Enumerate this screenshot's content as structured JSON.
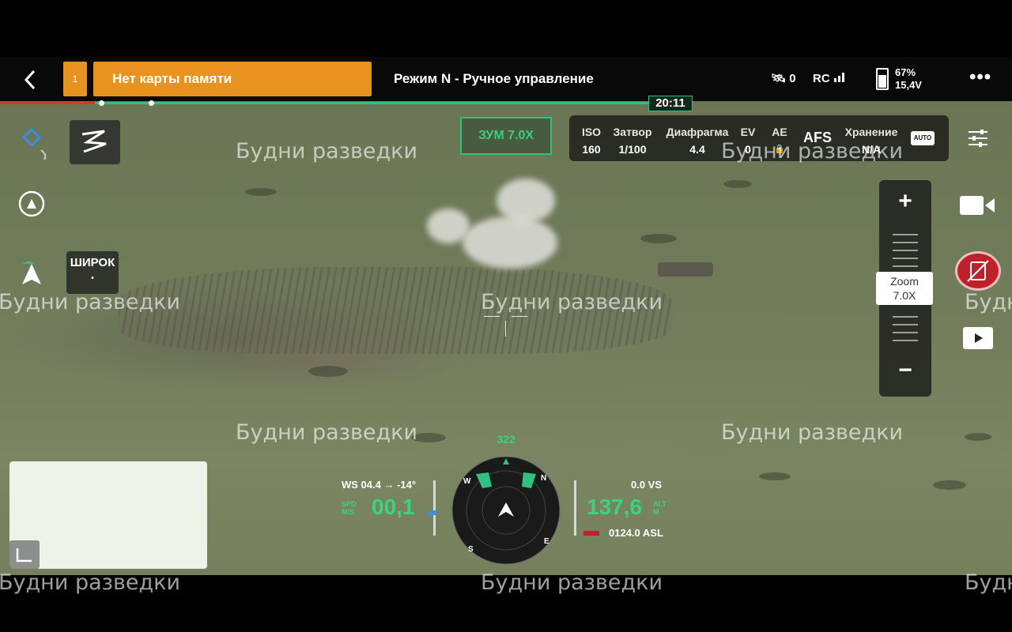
{
  "topbar": {
    "warning_count": "1",
    "warning_message": "Нет карты памяти",
    "flight_mode": "Режим N - Ручное управление",
    "satellites": "0",
    "rc_label": "RC",
    "battery_percent": "67%",
    "battery_voltage": "15,4V",
    "more_label": "•••"
  },
  "video": {
    "elapsed_time": "20:11",
    "progress_fraction": 0.64
  },
  "left_panel": {
    "wide_label": "ШИРОК",
    "wide_sub": "•"
  },
  "camera": {
    "zoom_badge": "ЗУМ 7.0X",
    "params": [
      {
        "label": "ISO",
        "value": "160"
      },
      {
        "label": "Затвор",
        "value": "1/100"
      },
      {
        "label": "Диафрагма",
        "value": "4.4"
      },
      {
        "label": "EV",
        "value": "0"
      },
      {
        "label": "AE",
        "value": "🔒"
      },
      {
        "label": "Хранение",
        "value": "N/A"
      }
    ],
    "focus_mode": "AFS",
    "auto_label": "AUTO"
  },
  "zoom_control": {
    "plus": "+",
    "minus": "−",
    "label": "Zoom",
    "value": "7.0X",
    "level_fraction": 0.5
  },
  "telemetry": {
    "wind": "WS 04.4 → -14°",
    "horizontal_speed": "00,1",
    "hs_unit_top": "SPD",
    "hs_unit_bottom": "M/S",
    "vertical_speed": "0.0  VS",
    "altitude": "137,6",
    "alt_unit_top": "ALT",
    "alt_unit_bottom": "M",
    "asl": "0124.0 ASL",
    "heading": "322"
  },
  "watermark": "Будни разведки",
  "colors": {
    "warning": "#e8921f",
    "accent_green": "#2ec27e",
    "record_red": "#c0202a"
  },
  "icons": [
    "back-icon",
    "gps-icon",
    "map-route-icon",
    "home-point-icon",
    "aircraft-icon",
    "satellite-icon",
    "signal-icon",
    "battery-icon",
    "more-icon",
    "settings-sliders-icon",
    "video-camera-icon",
    "record-icon",
    "playback-icon",
    "minimap-toggle-icon",
    "compass-icon"
  ]
}
